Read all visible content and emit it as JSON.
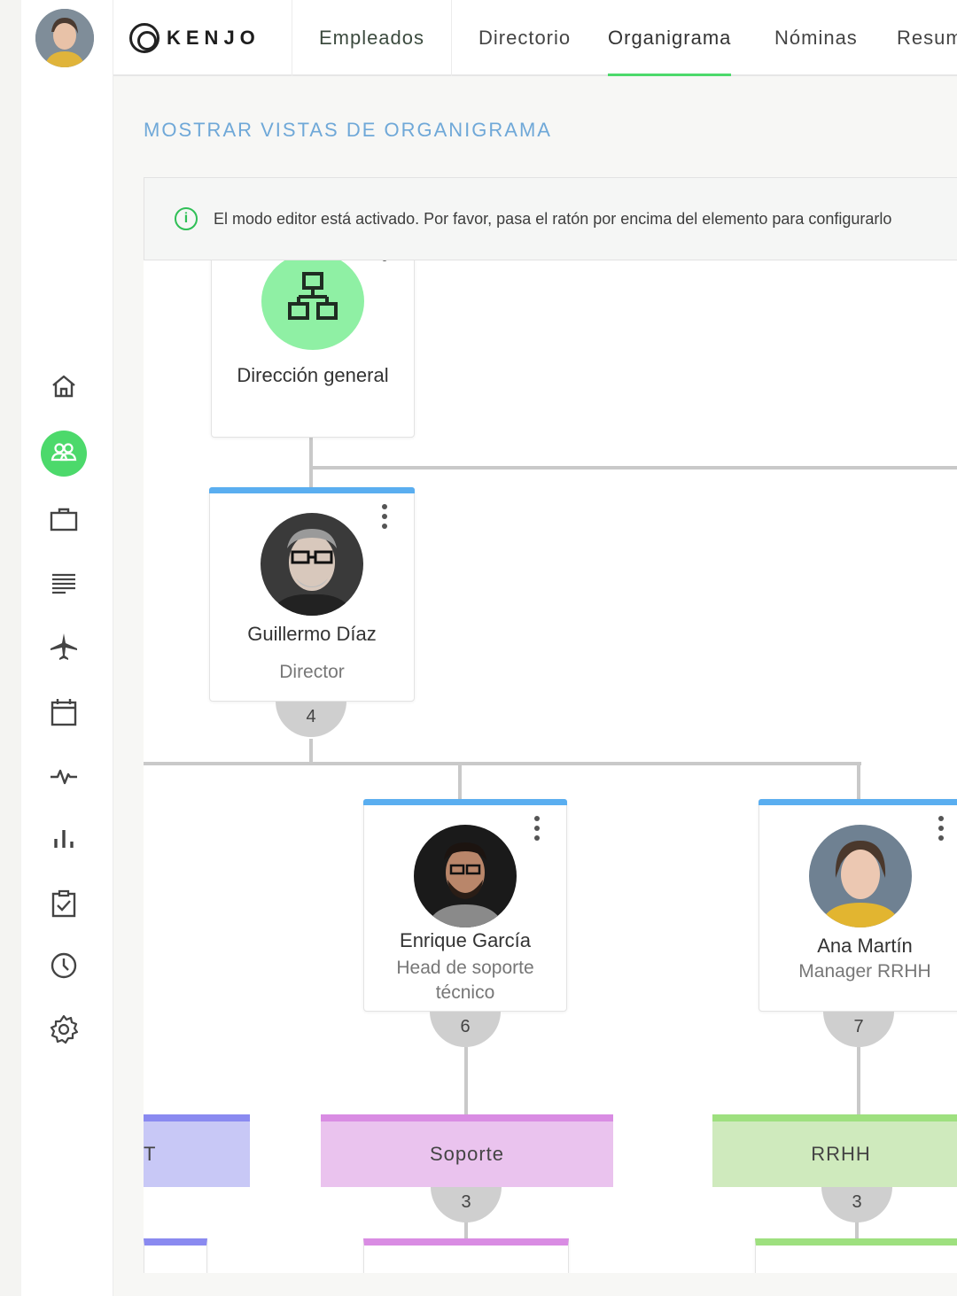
{
  "app": {
    "brand": "KENJO"
  },
  "nav": {
    "primary": "Empleados",
    "tabs": [
      {
        "label": "Directorio",
        "active": false
      },
      {
        "label": "Organigrama",
        "active": true
      },
      {
        "label": "Nóminas",
        "active": false
      },
      {
        "label": "Resum",
        "active": false
      }
    ]
  },
  "sidebar": {
    "items": [
      {
        "icon": "home-icon",
        "active": false
      },
      {
        "icon": "people-icon",
        "active": true
      },
      {
        "icon": "briefcase-icon",
        "active": false
      },
      {
        "icon": "list-icon",
        "active": false
      },
      {
        "icon": "airplane-icon",
        "active": false
      },
      {
        "icon": "calendar-icon",
        "active": false
      },
      {
        "icon": "pulse-icon",
        "active": false
      },
      {
        "icon": "bar-chart-icon",
        "active": false
      },
      {
        "icon": "checklist-icon",
        "active": false
      },
      {
        "icon": "clock-icon",
        "active": false
      },
      {
        "icon": "gear-icon",
        "active": false
      }
    ]
  },
  "main": {
    "views_link": "MOSTRAR VISTAS DE ORGANIGRAMA",
    "notice": "El modo editor está activado. Por favor, pasa el ratón por encima del elemento para configurarlo"
  },
  "org": {
    "root": {
      "name": "Dirección general"
    },
    "director": {
      "name": "Guillermo Díaz",
      "role": "Director",
      "count": "4"
    },
    "reports": [
      {
        "name": "Enrique García",
        "role_line1": "Head de soporte",
        "role_line2": "técnico",
        "count": "6"
      },
      {
        "name": "Ana Martín",
        "role": "Manager RRHH",
        "count": "7"
      }
    ],
    "departments": [
      {
        "name": "T",
        "color": "#c8c8f6",
        "accent": "#8a8af0"
      },
      {
        "name": "Soporte",
        "count": "3",
        "color": "#eac3ee",
        "accent": "#d98ce3"
      },
      {
        "name": "RRHH",
        "count": "3",
        "color": "#cfeabd",
        "accent": "#9ee07f"
      }
    ]
  },
  "colors": {
    "accent": "#4cd96b",
    "link": "#6fa8d8",
    "card_top": "#5aaef0"
  }
}
